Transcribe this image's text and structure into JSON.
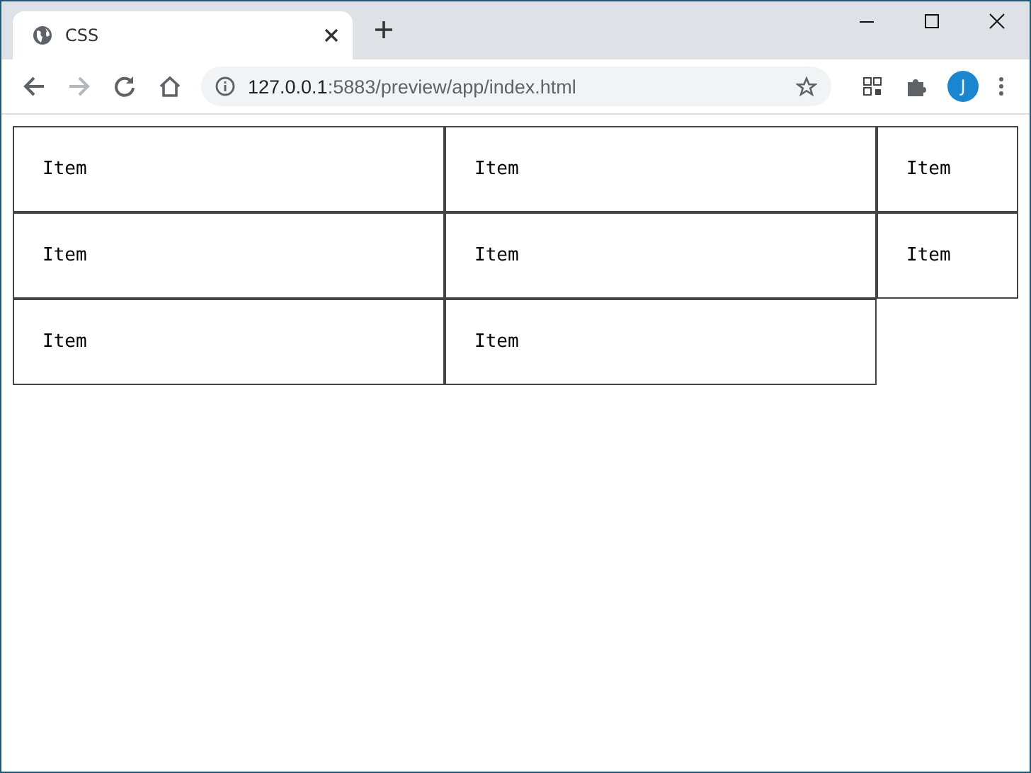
{
  "window": {
    "tab": {
      "title": "CSS"
    },
    "address": {
      "host": "127.0.0.1",
      "rest": ":5883/preview/app/index.html"
    },
    "profile": {
      "initial": "J"
    }
  },
  "page": {
    "items": [
      {
        "label": "Item"
      },
      {
        "label": "Item"
      },
      {
        "label": "Item"
      },
      {
        "label": "Item"
      },
      {
        "label": "Item"
      },
      {
        "label": "Item"
      },
      {
        "label": "Item"
      },
      {
        "label": "Item"
      }
    ]
  }
}
